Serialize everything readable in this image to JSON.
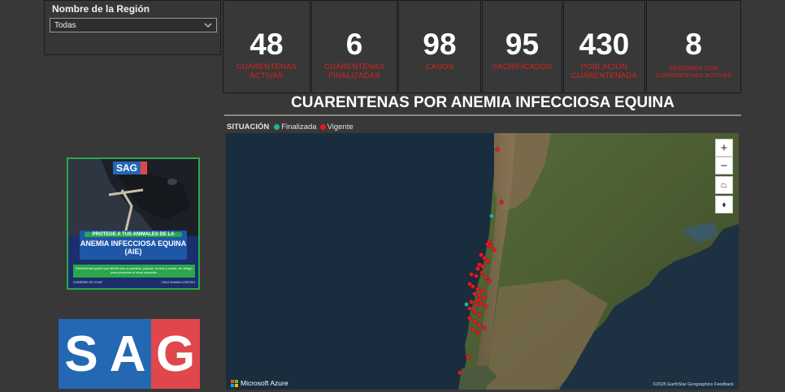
{
  "filter": {
    "label": "Nombre de la Región",
    "selected": "Todas"
  },
  "kpis": [
    {
      "value": "48",
      "label": "CUARENTENAS ACTIVAS"
    },
    {
      "value": "6",
      "label": "CUARENTENAS FINALIZADAS"
    },
    {
      "value": "98",
      "label": "CASOS"
    },
    {
      "value": "95",
      "label": "SACRIFICADOS"
    },
    {
      "value": "430",
      "label": "POBLACIÓN CUARENTENADA"
    },
    {
      "value": "8",
      "label": "REGIONES CON CUARENTENAS ACTIVAS"
    }
  ],
  "section_title": "CUARENTENAS POR ANEMIA INFECCIOSA EQUINA",
  "legend": {
    "title": "SITUACIÓN",
    "items": [
      {
        "label": "Finalizada",
        "color": "#1fb39b"
      },
      {
        "label": "Vigente",
        "color": "#e8191b"
      }
    ]
  },
  "map": {
    "controls": {
      "zoom_in": "+",
      "zoom_out": "−",
      "tilt": "⏢",
      "compass": "⬧"
    },
    "provider": "Microsoft Azure",
    "attribution": "©2025 EarthStar Geographics  Feedback"
  },
  "poster": {
    "brand": "SAG",
    "tagline": "PROTEGE A TUS ANIMALES DE LA",
    "headline": "ANEMIA INFECCIOSA EQUINA (AIE)",
    "body": "Enfermedad grave que afecta solo a caballos, yeguas, burros y mulas, sin riesgo para personas ni otras especies.",
    "footer_left": "GOBIERNO DE CHILE",
    "footer_right": "CHILE AVANZA CONTIGO"
  },
  "logo": {
    "letters": [
      "S",
      "A",
      "G"
    ],
    "colors": [
      "#2468b4",
      "#2468b4",
      "#e0474c"
    ]
  },
  "colors": {
    "kpi_label": "#e0201d",
    "background": "#383838"
  }
}
